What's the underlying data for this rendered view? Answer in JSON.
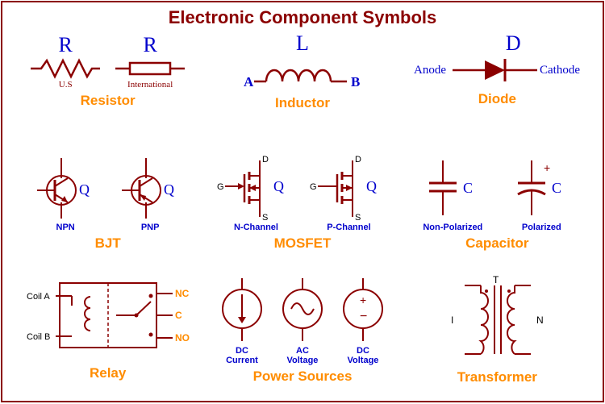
{
  "title": "Electronic Component Symbols",
  "cells": {
    "resistor": {
      "label": "Resistor",
      "letter": "R",
      "variants": [
        {
          "sub": "U.S"
        },
        {
          "sub": "International"
        }
      ]
    },
    "inductor": {
      "label": "Inductor",
      "letter": "L",
      "terminals": {
        "a": "A",
        "b": "B"
      }
    },
    "diode": {
      "label": "Diode",
      "letter": "D",
      "terminals": {
        "anode": "Anode",
        "cathode": "Cathode"
      }
    },
    "bjt": {
      "label": "BJT",
      "letter": "Q",
      "variants": [
        {
          "sub": "NPN"
        },
        {
          "sub": "PNP"
        }
      ]
    },
    "mosfet": {
      "label": "MOSFET",
      "letter": "Q",
      "pins": {
        "g": "G",
        "d": "D",
        "s": "S"
      },
      "variants": [
        {
          "sub": "N-Channel"
        },
        {
          "sub": "P-Channel"
        }
      ]
    },
    "capacitor": {
      "label": "Capacitor",
      "letter": "C",
      "variants": [
        {
          "sub": "Non-Polarized"
        },
        {
          "sub": "Polarized"
        }
      ]
    },
    "relay": {
      "label": "Relay",
      "pins": {
        "coilA": "Coil A",
        "coilB": "Coil B",
        "nc": "NC",
        "c": "C",
        "no": "NO"
      }
    },
    "power": {
      "label": "Power Sources",
      "variants": [
        {
          "sub1": "DC",
          "sub2": "Current"
        },
        {
          "sub1": "AC",
          "sub2": "Voltage"
        },
        {
          "sub1": "DC",
          "sub2": "Voltage"
        }
      ]
    },
    "transformer": {
      "label": "Transformer",
      "pins": {
        "t": "T",
        "i": "I",
        "n": "N"
      }
    }
  }
}
